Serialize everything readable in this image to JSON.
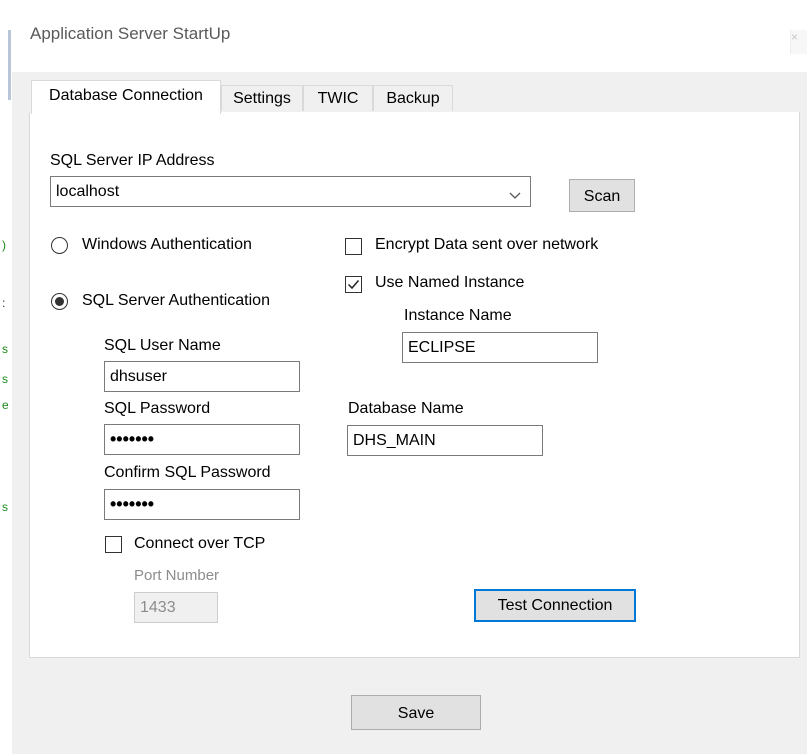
{
  "window": {
    "title": "Application Server StartUp",
    "close_glyph": "×"
  },
  "side_fragments": [
    ")",
    ":",
    "s",
    "s",
    "e",
    "s"
  ],
  "tabs": [
    {
      "label": "Database Connection",
      "active": true
    },
    {
      "label": "Settings",
      "active": false
    },
    {
      "label": "TWIC",
      "active": false
    },
    {
      "label": "Backup",
      "active": false
    }
  ],
  "db": {
    "server_ip_label": "SQL Server IP Address",
    "server_ip_value": "localhost",
    "scan_label": "Scan",
    "windows_auth_label": "Windows Authentication",
    "windows_auth_selected": false,
    "sql_auth_label": "SQL Server Authentication",
    "sql_auth_selected": true,
    "user_name_label": "SQL User Name",
    "user_name_value": "dhsuser",
    "password_label": "SQL Password",
    "password_value": "•••••••",
    "confirm_password_label": "Confirm SQL Password",
    "confirm_password_value": "•••••••",
    "connect_tcp_label": "Connect over TCP",
    "connect_tcp_checked": false,
    "port_label": "Port Number",
    "port_value": "1433",
    "encrypt_label": "Encrypt Data sent over network",
    "encrypt_checked": false,
    "named_instance_label": "Use Named Instance",
    "named_instance_checked": true,
    "instance_name_label": "Instance Name",
    "instance_name_value": "ECLIPSE",
    "database_name_label": "Database Name",
    "database_name_value": "DHS_MAIN",
    "test_connection_label": "Test Connection",
    "dropdown_icon": "chevron-down-icon",
    "check_icon": "checkmark-icon"
  },
  "footer": {
    "save_label": "Save"
  },
  "colors": {
    "window_bg": "#f0f0f0",
    "panel_bg": "#ffffff",
    "focus_border": "#0078d7",
    "button_bg": "#e1e1e1",
    "side_fragment_color": "#1a8a1a"
  }
}
